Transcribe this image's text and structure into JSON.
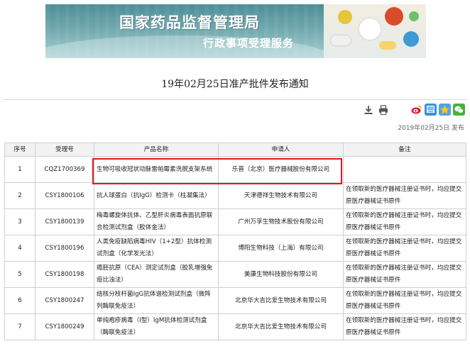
{
  "banner": {
    "title": "国家药品监督管理局",
    "subtitle": "行政事项受理服务"
  },
  "notice": {
    "title": "19年02月25日准产批件发布通知",
    "publish_date": "2019年02月25日 发布"
  },
  "toolbar": {
    "icons": [
      "download-icon",
      "print-icon"
    ],
    "share_icons": [
      "weibo-icon",
      "qzone-icon",
      "star-icon",
      "wechat-icon"
    ]
  },
  "colors": {
    "highlight_border": "#e3161c",
    "banner_teal": "#4e8e96"
  },
  "table": {
    "headers": [
      "序号",
      "受理号",
      "产品名称",
      "申请人",
      "备注"
    ],
    "rows": [
      {
        "no": "1",
        "acceptance": "CQZ1700369",
        "product": "生物可吸收冠状动脉雷帕霉素洗脱支架系统",
        "applicant": "乐普（北京）医疗器械股份有限公司",
        "note": ""
      },
      {
        "no": "2",
        "acceptance": "CSY1800106",
        "product": "抗人球蛋白（抗IgG）检测卡（柱凝集法）",
        "applicant": "天津德祥生物技术有限公司",
        "note": "在领取新的医疗器械注册证书时，均应提交原医疗器械证书原件"
      },
      {
        "no": "3",
        "acceptance": "CSY1800139",
        "product": "梅毒螺旋体抗体、乙型肝炎病毒表面抗原联合检测试剂盒（胶体金法）",
        "applicant": "广州万孚生物技术股份有限公司",
        "note": "在领取新的医疗器械注册证书时，均应提交原医疗器械证书原件"
      },
      {
        "no": "4",
        "acceptance": "CSY1800196",
        "product": "人类免疫缺陷病毒HIV（1+2型）抗体检测试剂盒（化学发光法）",
        "applicant": "博阳生物科技（上海）有限公司",
        "note": "在领取新的医疗器械注册证书时，均应提交原医疗器械证书原件"
      },
      {
        "no": "5",
        "acceptance": "CSY1800198",
        "product": "癌胚抗原（CEA）测定试剂盒（胶乳增强免疫比浊法）",
        "applicant": "美康生物科技股份有限公司",
        "note": "在领取新的医疗器械注册证书时，均应提交原医疗器械证书原件"
      },
      {
        "no": "6",
        "acceptance": "CSY1800247",
        "product": "结核分枝杆菌IgG抗体谱检测试剂盒（微阵列酶联免疫法）",
        "applicant": "北京华大吉比爱生物技术有限公司",
        "note": "在领取新的医疗器械注册证书时，均应提交原医疗器械证书原件"
      },
      {
        "no": "7",
        "acceptance": "CSY1800249",
        "product": "单纯疱疹病毒（Ⅰ型）IgM抗体检测试剂盒（酶联免疫法）",
        "applicant": "北京华大吉比爱生物技术有限公司",
        "note": "在领取新的医疗器械注册证书时，均应提交原医疗器械证书原件"
      }
    ]
  }
}
